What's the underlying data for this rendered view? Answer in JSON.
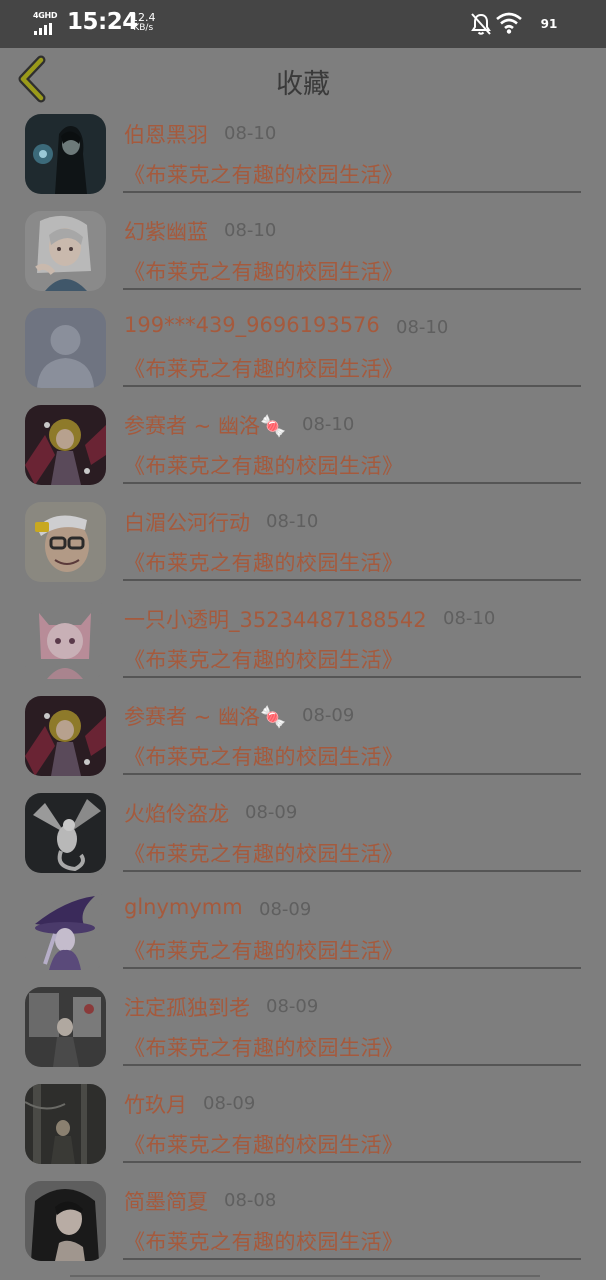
{
  "status_bar": {
    "network": "4GHD",
    "time": "15:24",
    "speed_value": "12.4",
    "speed_unit": "KB/s",
    "battery": "91"
  },
  "header": {
    "title": "收藏"
  },
  "items": [
    {
      "name": "伯恩黑羽",
      "date": "08-10",
      "book": "《布莱克之有趣的校园生活》"
    },
    {
      "name": "幻紫幽蓝",
      "date": "08-10",
      "book": "《布莱克之有趣的校园生活》"
    },
    {
      "name": "199***439_9696193576",
      "date": "08-10",
      "book": "《布莱克之有趣的校园生活》"
    },
    {
      "name": "参赛者 ~ 幽洛🍬",
      "date": "08-10",
      "book": "《布莱克之有趣的校园生活》"
    },
    {
      "name": "白湄公河行动",
      "date": "08-10",
      "book": "《布莱克之有趣的校园生活》"
    },
    {
      "name": "一只小透明_35234487188542",
      "date": "08-10",
      "book": "《布莱克之有趣的校园生活》"
    },
    {
      "name": "参赛者 ~ 幽洛🍬",
      "date": "08-09",
      "book": "《布莱克之有趣的校园生活》"
    },
    {
      "name": "火焰伶盗龙",
      "date": "08-09",
      "book": "《布莱克之有趣的校园生活》"
    },
    {
      "name": "glnymymm",
      "date": "08-09",
      "book": "《布莱克之有趣的校园生活》"
    },
    {
      "name": "注定孤独到老",
      "date": "08-09",
      "book": "《布莱克之有趣的校园生活》"
    },
    {
      "name": "竹玖月",
      "date": "08-09",
      "book": "《布莱克之有趣的校园生活》"
    },
    {
      "name": "简墨简夏",
      "date": "08-08",
      "book": "《布莱克之有趣的校园生活》"
    }
  ]
}
